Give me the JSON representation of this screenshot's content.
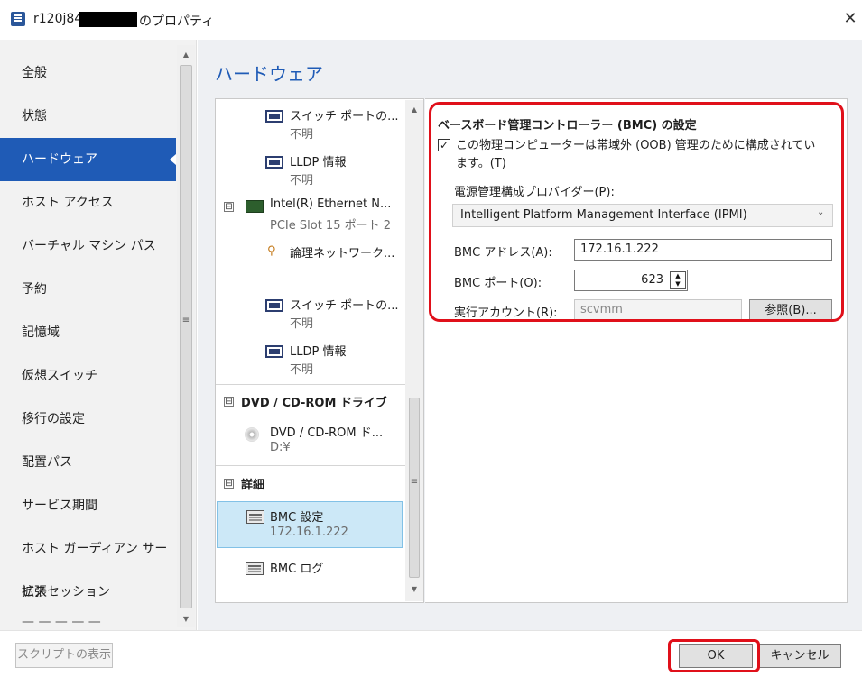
{
  "window": {
    "title_prefix": "r120j84",
    "title_suffix": "のプロパティ",
    "close_glyph": "✕"
  },
  "sidebar": {
    "items": [
      {
        "label": "全般"
      },
      {
        "label": "状態"
      },
      {
        "label": "ハードウェア",
        "selected": true
      },
      {
        "label": "ホスト アクセス"
      },
      {
        "label": "バーチャル マシン パス"
      },
      {
        "label": "予約"
      },
      {
        "label": "記憶域"
      },
      {
        "label": "仮想スイッチ"
      },
      {
        "label": "移行の設定"
      },
      {
        "label": "配置パス"
      },
      {
        "label": "サービス期間"
      },
      {
        "label": "ホスト ガーディアン サービス"
      },
      {
        "label": "拡張セッション"
      }
    ],
    "scroll_grip": "≡"
  },
  "main": {
    "section_title": "ハードウェア"
  },
  "tree": {
    "switch_port_1": {
      "label": "スイッチ ポートの...",
      "value": "不明"
    },
    "lldp_1": {
      "label": "LLDP 情報",
      "value": "不明"
    },
    "nic": {
      "expander": "⊟",
      "label": "Intel(R) Ethernet N...",
      "value": "PCIe Slot 15 ポート 2"
    },
    "logical_net": {
      "label": "論理ネットワーク..."
    },
    "switch_port_2": {
      "label": "スイッチ ポートの...",
      "value": "不明"
    },
    "lldp_2": {
      "label": "LLDP 情報",
      "value": "不明"
    },
    "dvd_group": {
      "expander": "⊟",
      "label": "DVD / CD-ROM ドライブ"
    },
    "dvd_item": {
      "label": "DVD / CD-ROM ド...",
      "value": "D:¥"
    },
    "details_group": {
      "expander": "⊟",
      "label": "詳細"
    },
    "bmc_settings": {
      "label": "BMC 設定",
      "value": "172.16.1.222",
      "selected": true
    },
    "bmc_log": {
      "label": "BMC ログ"
    },
    "scroll_grip": "≡"
  },
  "settings": {
    "title": "ベースボード管理コントローラー (BMC) の設定",
    "oob_checkbox": {
      "checked": true,
      "glyph": "✓",
      "label": "この物理コンピューターは帯域外 (OOB) 管理のために構成されています。(T)"
    },
    "provider_label": "電源管理構成プロバイダー(P):",
    "provider_value": "Intelligent Platform Management Interface (IPMI)",
    "bmc_address_label": "BMC アドレス(A):",
    "bmc_address_value": "172.16.1.222",
    "bmc_port_label": "BMC ポート(O):",
    "bmc_port_value": "623",
    "run_account_label": "実行アカウント(R):",
    "run_account_value": "scvmm",
    "browse_label": "参照(B)..."
  },
  "footer": {
    "script_label": "スクリプトの表示",
    "ok_label": "OK",
    "cancel_label": "キャンセル"
  },
  "colors": {
    "accent": "#1f5bb6",
    "highlight_red": "#e0101a",
    "tree_selection": "#cce8f7"
  }
}
